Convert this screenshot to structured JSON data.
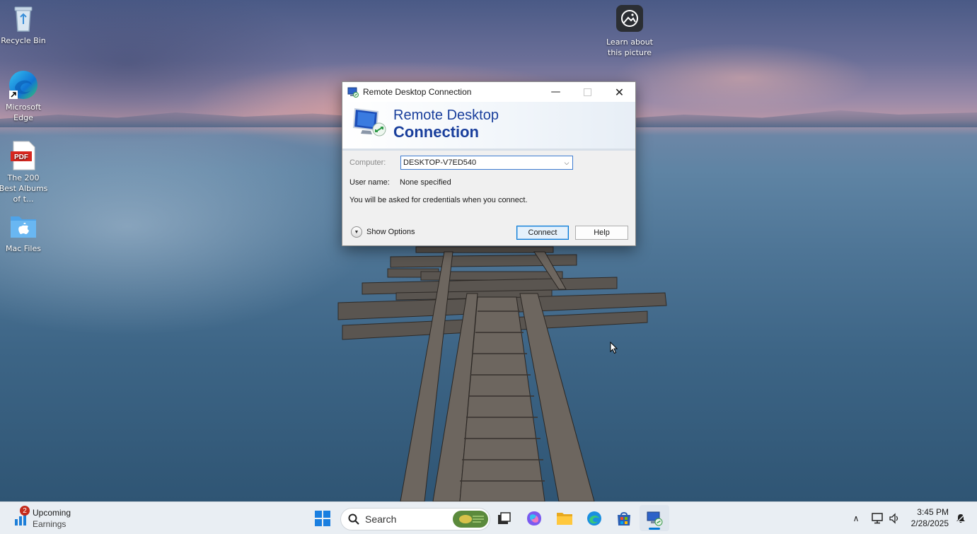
{
  "desktop": {
    "icons": [
      {
        "label": "Recycle Bin"
      },
      {
        "label": "Microsoft Edge"
      },
      {
        "label": "The 200 Best Albums of t...",
        "badge": "PDF"
      },
      {
        "label": "Mac Files"
      }
    ],
    "spotlight": {
      "label": "Learn about this picture"
    }
  },
  "window": {
    "title": "Remote Desktop Connection",
    "banner_line1": "Remote Desktop",
    "banner_line2": "Connection",
    "computer_label": "Computer:",
    "computer_value": "DESKTOP-V7ED540",
    "username_label": "User name:",
    "username_value": "None specified",
    "info_text": "You will be asked for credentials when you connect.",
    "show_options": "Show Options",
    "connect_label": "Connect",
    "help_label": "Help"
  },
  "taskbar": {
    "widget_title": "Upcoming",
    "widget_sub": "Earnings",
    "widget_badge": "2",
    "search_placeholder": "Search",
    "time": "3:45 PM",
    "date": "2/28/2025"
  },
  "colors": {
    "accent": "#0078d7",
    "banner_text": "#1a3f9c",
    "badge": "#c42b1c"
  }
}
